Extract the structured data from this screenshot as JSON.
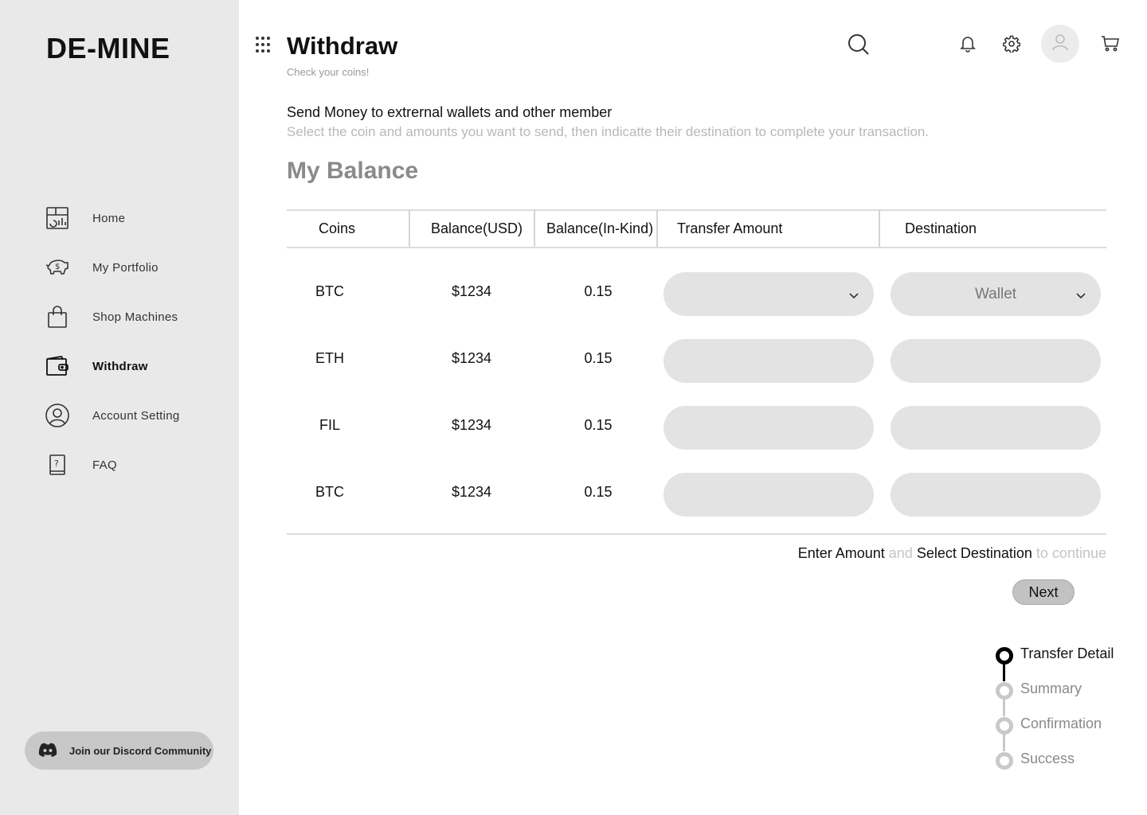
{
  "app": {
    "logo": "DE-MINE"
  },
  "sidebar": {
    "items": [
      {
        "label": "Home",
        "icon": "dashboard-icon",
        "active": false
      },
      {
        "label": "My Portfolio",
        "icon": "piggy-bank-icon",
        "active": false
      },
      {
        "label": "Shop Machines",
        "icon": "shopping-bag-icon",
        "active": false
      },
      {
        "label": "Withdraw",
        "icon": "wallet-icon",
        "active": true
      },
      {
        "label": "Account Setting",
        "icon": "user-circle-icon",
        "active": false
      },
      {
        "label": "FAQ",
        "icon": "question-book-icon",
        "active": false
      }
    ],
    "discord_label": "Join our Discord Community"
  },
  "header": {
    "title": "Withdraw",
    "subtitle": "Check your coins!",
    "icons": [
      "apps-grid-icon",
      "search-icon",
      "bell-icon",
      "gear-icon",
      "user-icon",
      "cart-icon"
    ]
  },
  "intro": {
    "heading": "Send Money to extrernal wallets and other member",
    "description": "Select the coin and amounts you want to send, then indicatte their destination to complete your transaction."
  },
  "balance": {
    "title": "My Balance",
    "columns": [
      "Coins",
      "Balance(USD)",
      "Balance(In-Kind)",
      "Transfer Amount",
      "Destination"
    ],
    "rows": [
      {
        "coin": "BTC",
        "usd": "$1234",
        "inkind": "0.15",
        "destination": "Wallet"
      },
      {
        "coin": "ETH",
        "usd": "$1234",
        "inkind": "0.15",
        "destination": ""
      },
      {
        "coin": "FIL",
        "usd": "$1234",
        "inkind": "0.15",
        "destination": ""
      },
      {
        "coin": "BTC",
        "usd": "$1234",
        "inkind": "0.15",
        "destination": ""
      }
    ]
  },
  "hint": {
    "part1": "Enter Amount",
    "part2": " and ",
    "part3": "Select Destination",
    "part4": " to continue"
  },
  "next_label": "Next",
  "steps": [
    {
      "label": "Transfer Detail",
      "state": "active"
    },
    {
      "label": "Summary",
      "state": "pending"
    },
    {
      "label": "Confirmation",
      "state": "pending"
    },
    {
      "label": "Success",
      "state": "pending"
    }
  ],
  "colors": {
    "sidebar_bg": "#e9e9e9",
    "pill_bg": "#e3e3e3",
    "button_bg": "#c2c2c2",
    "accent": "#000000"
  }
}
